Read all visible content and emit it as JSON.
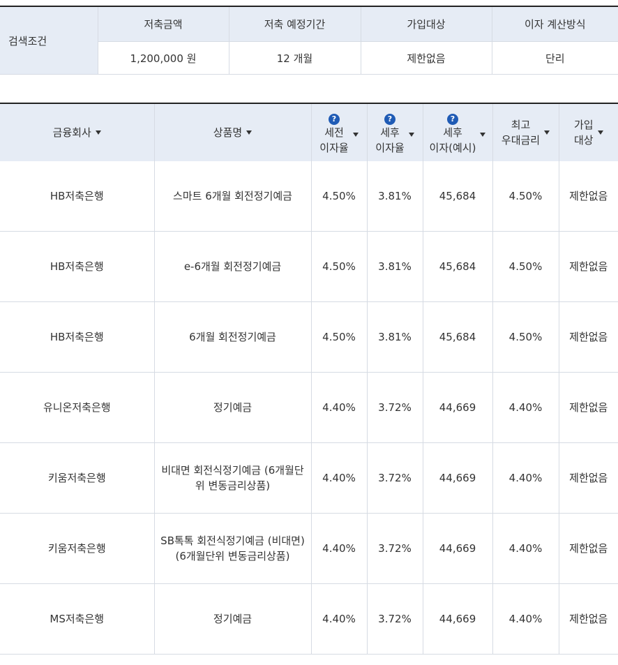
{
  "search": {
    "title": "검색조건",
    "columns": [
      {
        "header": "저축금액",
        "value": "1,200,000 원"
      },
      {
        "header": "저축 예정기간",
        "value": "12 개월"
      },
      {
        "header": "가입대상",
        "value": "제한없음"
      },
      {
        "header": "이자 계산방식",
        "value": "단리"
      }
    ]
  },
  "results": {
    "headers": {
      "company": "금융회사",
      "product": "상품명",
      "pretax_rate": [
        "세전",
        "이자율"
      ],
      "aftertax_rate": [
        "세후",
        "이자율"
      ],
      "aftertax_interest": [
        "세후",
        "이자(예시)"
      ],
      "max_rate": [
        "최고",
        "우대금리"
      ],
      "target": [
        "가입",
        "대상"
      ],
      "help_glyph": "?"
    },
    "icons": {
      "sort": "caret-down-icon",
      "help": "question-circle-icon"
    },
    "colors": {
      "header_bg": "#e6ecf5",
      "help_icon": "#1f5bb5",
      "border": "#d6dbe3"
    },
    "rows": [
      {
        "company": "HB저축은행",
        "product": "스마트 6개월 회전정기예금",
        "pretax_rate": "4.50%",
        "aftertax_rate": "3.81%",
        "aftertax_interest": "45,684",
        "max_rate": "4.50%",
        "target": "제한없음"
      },
      {
        "company": "HB저축은행",
        "product": "e-6개월 회전정기예금",
        "pretax_rate": "4.50%",
        "aftertax_rate": "3.81%",
        "aftertax_interest": "45,684",
        "max_rate": "4.50%",
        "target": "제한없음"
      },
      {
        "company": "HB저축은행",
        "product": "6개월 회전정기예금",
        "pretax_rate": "4.50%",
        "aftertax_rate": "3.81%",
        "aftertax_interest": "45,684",
        "max_rate": "4.50%",
        "target": "제한없음"
      },
      {
        "company": "유니온저축은행",
        "product": "정기예금",
        "pretax_rate": "4.40%",
        "aftertax_rate": "3.72%",
        "aftertax_interest": "44,669",
        "max_rate": "4.40%",
        "target": "제한없음"
      },
      {
        "company": "키움저축은행",
        "product": "비대면 회전식정기예금 (6개월단위 변동금리상품)",
        "pretax_rate": "4.40%",
        "aftertax_rate": "3.72%",
        "aftertax_interest": "44,669",
        "max_rate": "4.40%",
        "target": "제한없음"
      },
      {
        "company": "키움저축은행",
        "product": "SB톡톡 회전식정기예금 (비대면) (6개월단위 변동금리상품)",
        "pretax_rate": "4.40%",
        "aftertax_rate": "3.72%",
        "aftertax_interest": "44,669",
        "max_rate": "4.40%",
        "target": "제한없음"
      },
      {
        "company": "MS저축은행",
        "product": "정기예금",
        "pretax_rate": "4.40%",
        "aftertax_rate": "3.72%",
        "aftertax_interest": "44,669",
        "max_rate": "4.40%",
        "target": "제한없음"
      }
    ]
  }
}
